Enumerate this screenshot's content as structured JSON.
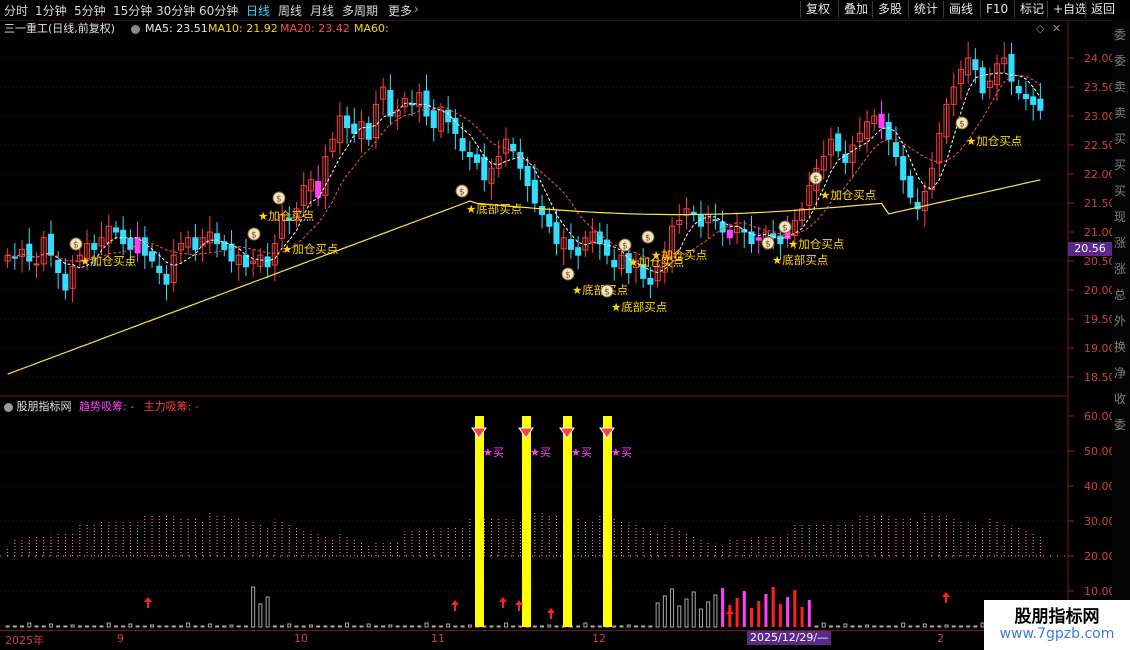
{
  "toolbar": {
    "periods": [
      "分时",
      "1分钟",
      "5分钟",
      "15分钟",
      "30分钟",
      "60分钟",
      "日线",
      "周线",
      "月线",
      "多周期",
      "更多"
    ],
    "active_period": "日线",
    "more_chevron": "›",
    "right_buttons": [
      "复权",
      "叠加",
      "多股",
      "统计",
      "画线",
      "F10",
      "标记",
      "+自选",
      "返回"
    ]
  },
  "info": {
    "title": "三一重工(日线,前复权)",
    "ma5": "MA5: 23.51",
    "ma10": "MA10: 21.92",
    "ma20": "MA20: 23.42",
    "ma60": "MA60:"
  },
  "price_axis": {
    "ticks": [
      "24.00",
      "23.50",
      "23.00",
      "22.50",
      "22.00",
      "21.50",
      "21.00",
      "20.50",
      "20.00",
      "19.50",
      "19.00",
      "18.50"
    ],
    "current_price": "20.56"
  },
  "indicator": {
    "name": "股朋指标网",
    "trend_label": "趋势吸筹: -",
    "main_label": "主力吸筹: -",
    "ticks": [
      "60.00",
      "50.00",
      "40.00",
      "30.00",
      "20.00",
      "10.00"
    ]
  },
  "annotations": {
    "add_position": "★加仓买点",
    "bottom_buy": "★底部买点",
    "buy": "★买"
  },
  "date_axis": {
    "labels": [
      "2025年",
      "9",
      "10",
      "11",
      "12",
      "2"
    ],
    "cursor_date": "2025/12/29/—"
  },
  "right_sidebar_chars": [
    "委",
    "委",
    "卖",
    "卖",
    "买",
    "买",
    "买",
    "现",
    "涨",
    "涨",
    "总",
    "外",
    "换",
    "净",
    "收",
    "委"
  ],
  "watermark": {
    "line1": "股朋指标网",
    "line2": "www.7gpzb.com"
  },
  "colors": {
    "up_candle": "#ff3e3e",
    "down_candle": "#33ddff",
    "highlight_candle": "#ff40ff",
    "ma60_line": "#ffe14d",
    "annotation": "#ffd700",
    "signal_bar": "#ffff00"
  }
}
